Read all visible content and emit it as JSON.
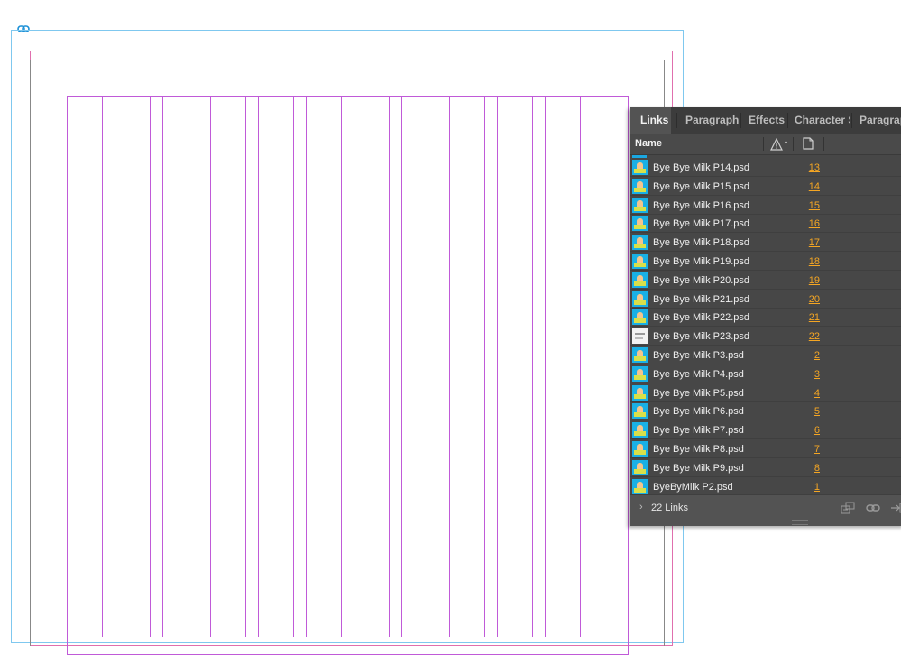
{
  "panel": {
    "tabs": [
      {
        "label": "Links",
        "active": true
      },
      {
        "label": "Paragraph",
        "active": false
      },
      {
        "label": "Effects",
        "active": false
      },
      {
        "label": "Character S",
        "active": false
      },
      {
        "label": "Paragrap",
        "active": false
      }
    ],
    "column_header": {
      "name": "Name",
      "status_icon": "warning-icon",
      "page_icon": "page-icon"
    },
    "links": [
      {
        "name": "Bye Bye Milk P14.psd",
        "page": "13"
      },
      {
        "name": "Bye Bye Milk P15.psd",
        "page": "14"
      },
      {
        "name": "Bye Bye Milk P16.psd",
        "page": "15"
      },
      {
        "name": "Bye Bye Milk P17.psd",
        "page": "16"
      },
      {
        "name": "Bye Bye Milk P18.psd",
        "page": "17"
      },
      {
        "name": "Bye Bye Milk P19.psd",
        "page": "18"
      },
      {
        "name": "Bye Bye Milk P20.psd",
        "page": "19"
      },
      {
        "name": "Bye Bye Milk P21.psd",
        "page": "20"
      },
      {
        "name": "Bye Bye Milk P22.psd",
        "page": "21"
      },
      {
        "name": "Bye Bye Milk P23.psd",
        "page": "22"
      },
      {
        "name": "Bye Bye Milk P3.psd",
        "page": "2"
      },
      {
        "name": "Bye Bye Milk P4.psd",
        "page": "3"
      },
      {
        "name": "Bye Bye Milk P5.psd",
        "page": "4"
      },
      {
        "name": "Bye Bye Milk P6.psd",
        "page": "5"
      },
      {
        "name": "Bye Bye Milk P7.psd",
        "page": "6"
      },
      {
        "name": "Bye Bye Milk P8.psd",
        "page": "7"
      },
      {
        "name": "Bye Bye Milk P9.psd",
        "page": "8"
      },
      {
        "name": "ByeByMilk P2.psd",
        "page": "1"
      }
    ],
    "footer": {
      "count_label": "22 Links",
      "icons": [
        "relink-to-folder-icon",
        "relink-icon",
        "go-to-link-icon"
      ]
    }
  },
  "colors": {
    "panel_bg": "#535353",
    "page_number": "#f5a623",
    "bleed_guide": "#7fc8ef",
    "margin_guide": "#c05ad8",
    "trim_guide": "#e06fae"
  }
}
